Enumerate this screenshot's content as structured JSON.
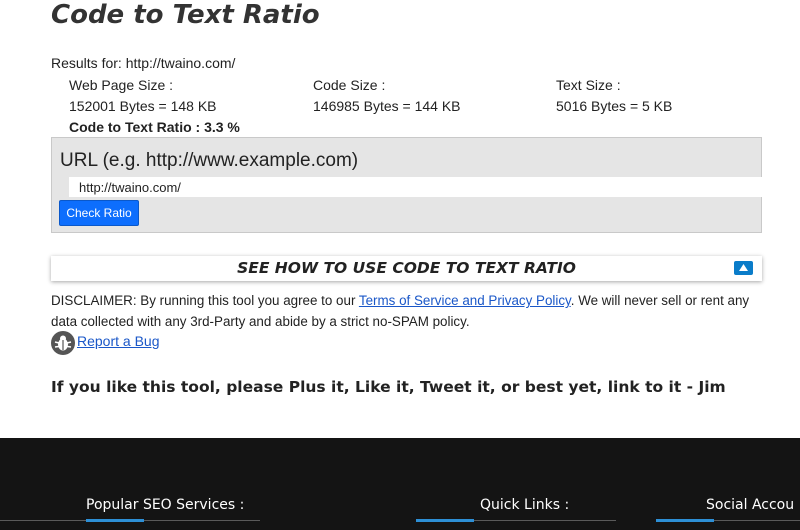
{
  "page": {
    "title": "Code to Text Ratio"
  },
  "results": {
    "results_for": "Results for: http://twaino.com/",
    "web_page_size": {
      "label": "Web Page Size :",
      "value": "152001 Bytes = 148 KB"
    },
    "code_size": {
      "label": "Code Size :",
      "value": "146985 Bytes = 144 KB"
    },
    "text_size": {
      "label": "Text Size :",
      "value": "5016 Bytes = 5 KB"
    },
    "ratio": "Code to Text Ratio : 3.3 %"
  },
  "form": {
    "url_label": "URL (e.g. http://www.example.com)",
    "url_value": "http://twaino.com/",
    "check_button": "Check Ratio"
  },
  "howto": {
    "label": "SEE HOW TO USE CODE TO TEXT RATIO"
  },
  "disclaimer": {
    "before": "DISCLAIMER: By running this tool you agree to our ",
    "link": "Terms of Service and Privacy Policy",
    "after": ". We will never sell or rent any data collected with any 3rd-Party and abide by a strict no-SPAM policy."
  },
  "report_bug": "Report a Bug",
  "plea": "If you like this tool, please Plus it, Like it, Tweet it, or best yet, link to it - Jim",
  "footer": {
    "headings": [
      "Popular SEO Services :",
      "Quick Links :",
      "Social Accou"
    ]
  },
  "colors": {
    "accent": "#0d6efd",
    "link": "#1a57c8",
    "footer_bg": "#141414",
    "footer_accent": "#2d8fd5"
  },
  "icons": [
    "bug-icon",
    "chevron-up-icon"
  ]
}
